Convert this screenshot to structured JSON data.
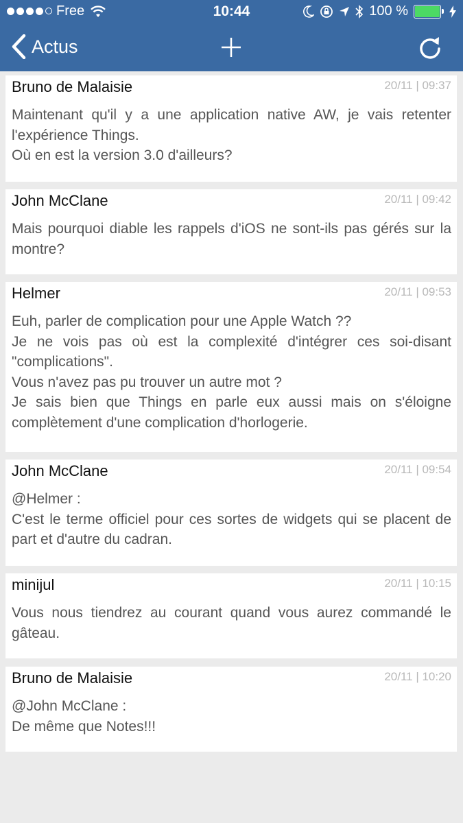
{
  "status_bar": {
    "carrier": "Free",
    "time": "10:44",
    "battery": "100 %"
  },
  "nav": {
    "back_label": "Actus"
  },
  "comments": [
    {
      "author": "Bruno de Malaisie",
      "time": "20/11 | 09:37",
      "body": "Maintenant qu'il y a une application native AW, je vais retenter l'expérience Things.\nOù en est la version 3.0 d'ailleurs?"
    },
    {
      "author": "John McClane",
      "time": "20/11 | 09:42",
      "body": "Mais pourquoi diable les rappels d'iOS ne sont-ils pas gérés sur la montre?"
    },
    {
      "author": "Helmer",
      "time": "20/11 | 09:53",
      "body": "Euh, parler de complication pour une Apple Watch ??\nJe ne vois pas où est la complexité d'intégrer ces soi-disant \"complications\".\nVous n'avez pas pu trouver un autre mot ?\nJe sais bien que Things en parle eux aussi mais on s'éloigne complètement d'une complication d'horlogerie."
    },
    {
      "author": "John McClane",
      "time": "20/11 | 09:54",
      "body": "@Helmer :\nC'est le terme officiel pour ces sortes de widgets qui se placent de part et d'autre du cadran."
    },
    {
      "author": "minijul",
      "time": "20/11 | 10:15",
      "body": "Vous nous tiendrez au courant quand vous aurez commandé le gâteau."
    },
    {
      "author": "Bruno de Malaisie",
      "time": "20/11 | 10:20",
      "body": "@John McClane :\nDe même que Notes!!!"
    }
  ]
}
